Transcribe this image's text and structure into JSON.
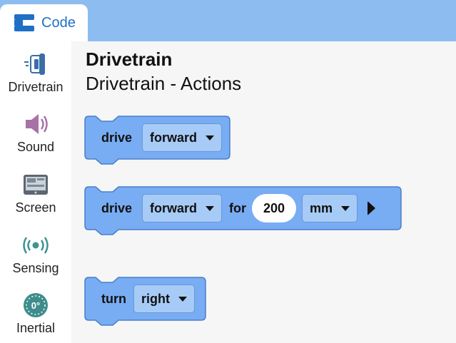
{
  "header": {
    "tab_label": "Code"
  },
  "sidebar": {
    "items": [
      {
        "label": "Drivetrain",
        "icon": "drivetrain-icon"
      },
      {
        "label": "Sound",
        "icon": "speaker-icon"
      },
      {
        "label": "Screen",
        "icon": "screen-icon"
      },
      {
        "label": "Sensing",
        "icon": "sensing-icon"
      },
      {
        "label": "Inertial",
        "icon": "inertial-icon"
      }
    ]
  },
  "workspace": {
    "title": "Drivetrain",
    "subtitle": "Drivetrain - Actions",
    "blocks": [
      {
        "keyword": "drive",
        "direction": "forward"
      },
      {
        "keyword": "drive",
        "direction": "forward",
        "for_label": "for",
        "distance": "200",
        "unit": "mm"
      },
      {
        "keyword": "turn",
        "direction": "right"
      }
    ]
  },
  "inertial_icon_text": "0°",
  "colors": {
    "topbar": "#8dbdf0",
    "block_fill": "#78acf3",
    "block_border": "#4a7fc9",
    "tab_text": "#1f6fc5"
  }
}
